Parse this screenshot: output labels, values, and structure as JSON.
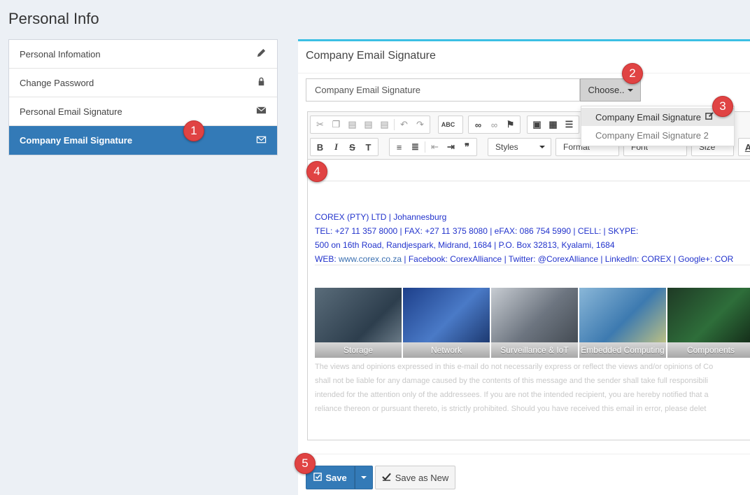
{
  "page": {
    "title": "Personal Info"
  },
  "sidebar": {
    "items": [
      {
        "label": "Personal Infomation",
        "icon": "pencil-icon",
        "active": false
      },
      {
        "label": "Change Password",
        "icon": "lock-icon",
        "active": false
      },
      {
        "label": "Personal Email Signature",
        "icon": "envelope-icon",
        "active": false
      },
      {
        "label": "Company Email Signature",
        "icon": "envelope-outline-icon",
        "active": true
      }
    ]
  },
  "main": {
    "title": "Company Email Signature",
    "signature_select": {
      "value": "Company Email Signature",
      "choose_label": "Choose..",
      "options": [
        {
          "label": "Company Email Signature",
          "selected": true
        },
        {
          "label": "Company Email Signature 2",
          "selected": false
        }
      ]
    },
    "toolbar": {
      "styles_label": "Styles",
      "format_label": "Format",
      "font_label": "Font",
      "size_label": "Size"
    },
    "signature": {
      "line1": "COREX (PTY) LTD | Johannesburg",
      "line2": "TEL: +27 11 357 8000 | FAX: +27 11 375 8080 | eFAX: 086 754 5990 | CELL:              | SKYPE:",
      "line3": "500 on 16th Road, Randjespark, Midrand, 1684 | P.O. Box 32813, Kyalami, 1684",
      "line4_prefix": "WEB: ",
      "line4_link": "www.corex.co.za",
      "line4_rest": " | Facebook: CorexAlliance | Twitter: @CorexAlliance | LinkedIn: COREX | Google+: COR"
    },
    "banner": [
      "Storage",
      "Network",
      "Surveillance & IoT",
      "Embedded Computing",
      "Components"
    ],
    "disclaimer": [
      "The views and opinions expressed in this e-mail do not necessarily express or reflect the views and/or opinions of Co",
      "shall not be liable for any damage caused by the contents of this message and the sender shall take full responsibili",
      "intended for the attention only of the addressees. If you are not the intended recipient, you are hereby notified that a",
      "reliance thereon or pursuant thereto, is strictly prohibited. Should you have received this email in error, please delet"
    ]
  },
  "footer": {
    "save_label": "Save",
    "save_as_new_label": "Save as New"
  },
  "badges": [
    "1",
    "2",
    "3",
    "4",
    "5"
  ],
  "colors": {
    "accent": "#337ab7",
    "badge": "#e04343",
    "signature_text": "#2233cc"
  }
}
